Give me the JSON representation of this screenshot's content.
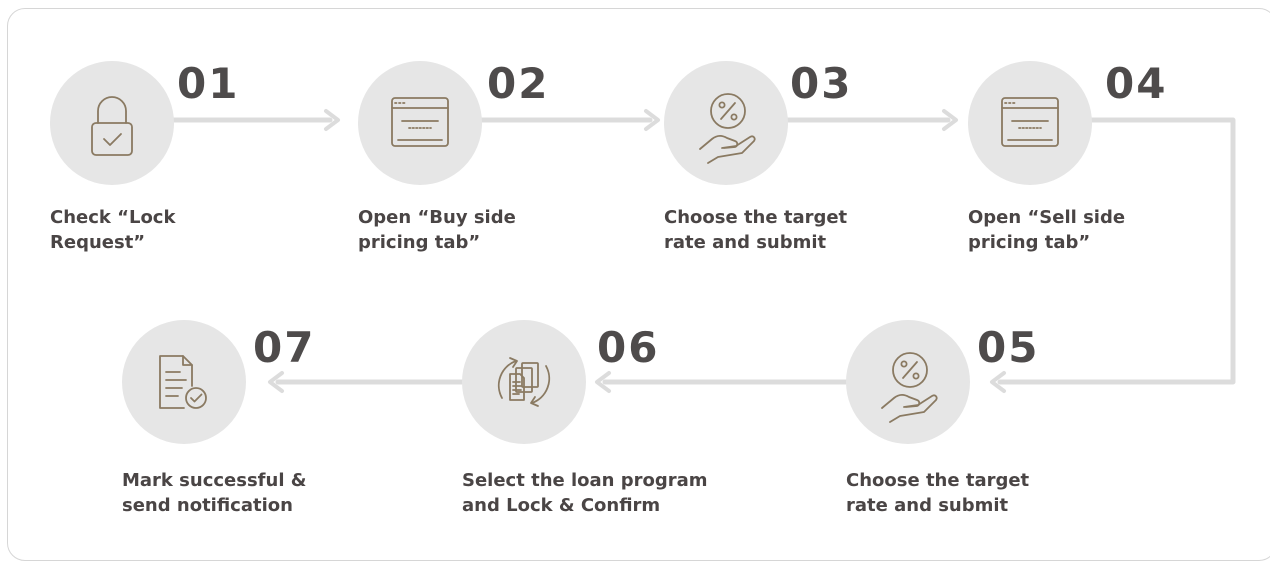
{
  "colors": {
    "circle_fill": "#e6e6e6",
    "icon_stroke": "#8a7a62",
    "connector": "#dcdcdc",
    "number_text": "#4e4b4b",
    "label_text": "#4a4545",
    "frame_border": "#d6d6d6"
  },
  "steps": [
    {
      "number": "01",
      "icon": "lock-check-icon",
      "line1": "Check “Lock",
      "line2": "Request”"
    },
    {
      "number": "02",
      "icon": "browser-window-icon",
      "line1": "Open “Buy side",
      "line2": "pricing tab”"
    },
    {
      "number": "03",
      "icon": "percent-hand-icon",
      "line1": "Choose the target",
      "line2": "rate and submit"
    },
    {
      "number": "04",
      "icon": "browser-window-icon",
      "line1": "Open “Sell side",
      "line2": "pricing tab”"
    },
    {
      "number": "05",
      "icon": "percent-hand-icon",
      "line1": "Choose the target",
      "line2": "rate and submit"
    },
    {
      "number": "06",
      "icon": "document-sync-icon",
      "line1": "Select the loan program",
      "line2": "and Lock & Confirm"
    },
    {
      "number": "07",
      "icon": "document-check-icon",
      "line1": "Mark successful &",
      "line2": "send notification"
    }
  ]
}
